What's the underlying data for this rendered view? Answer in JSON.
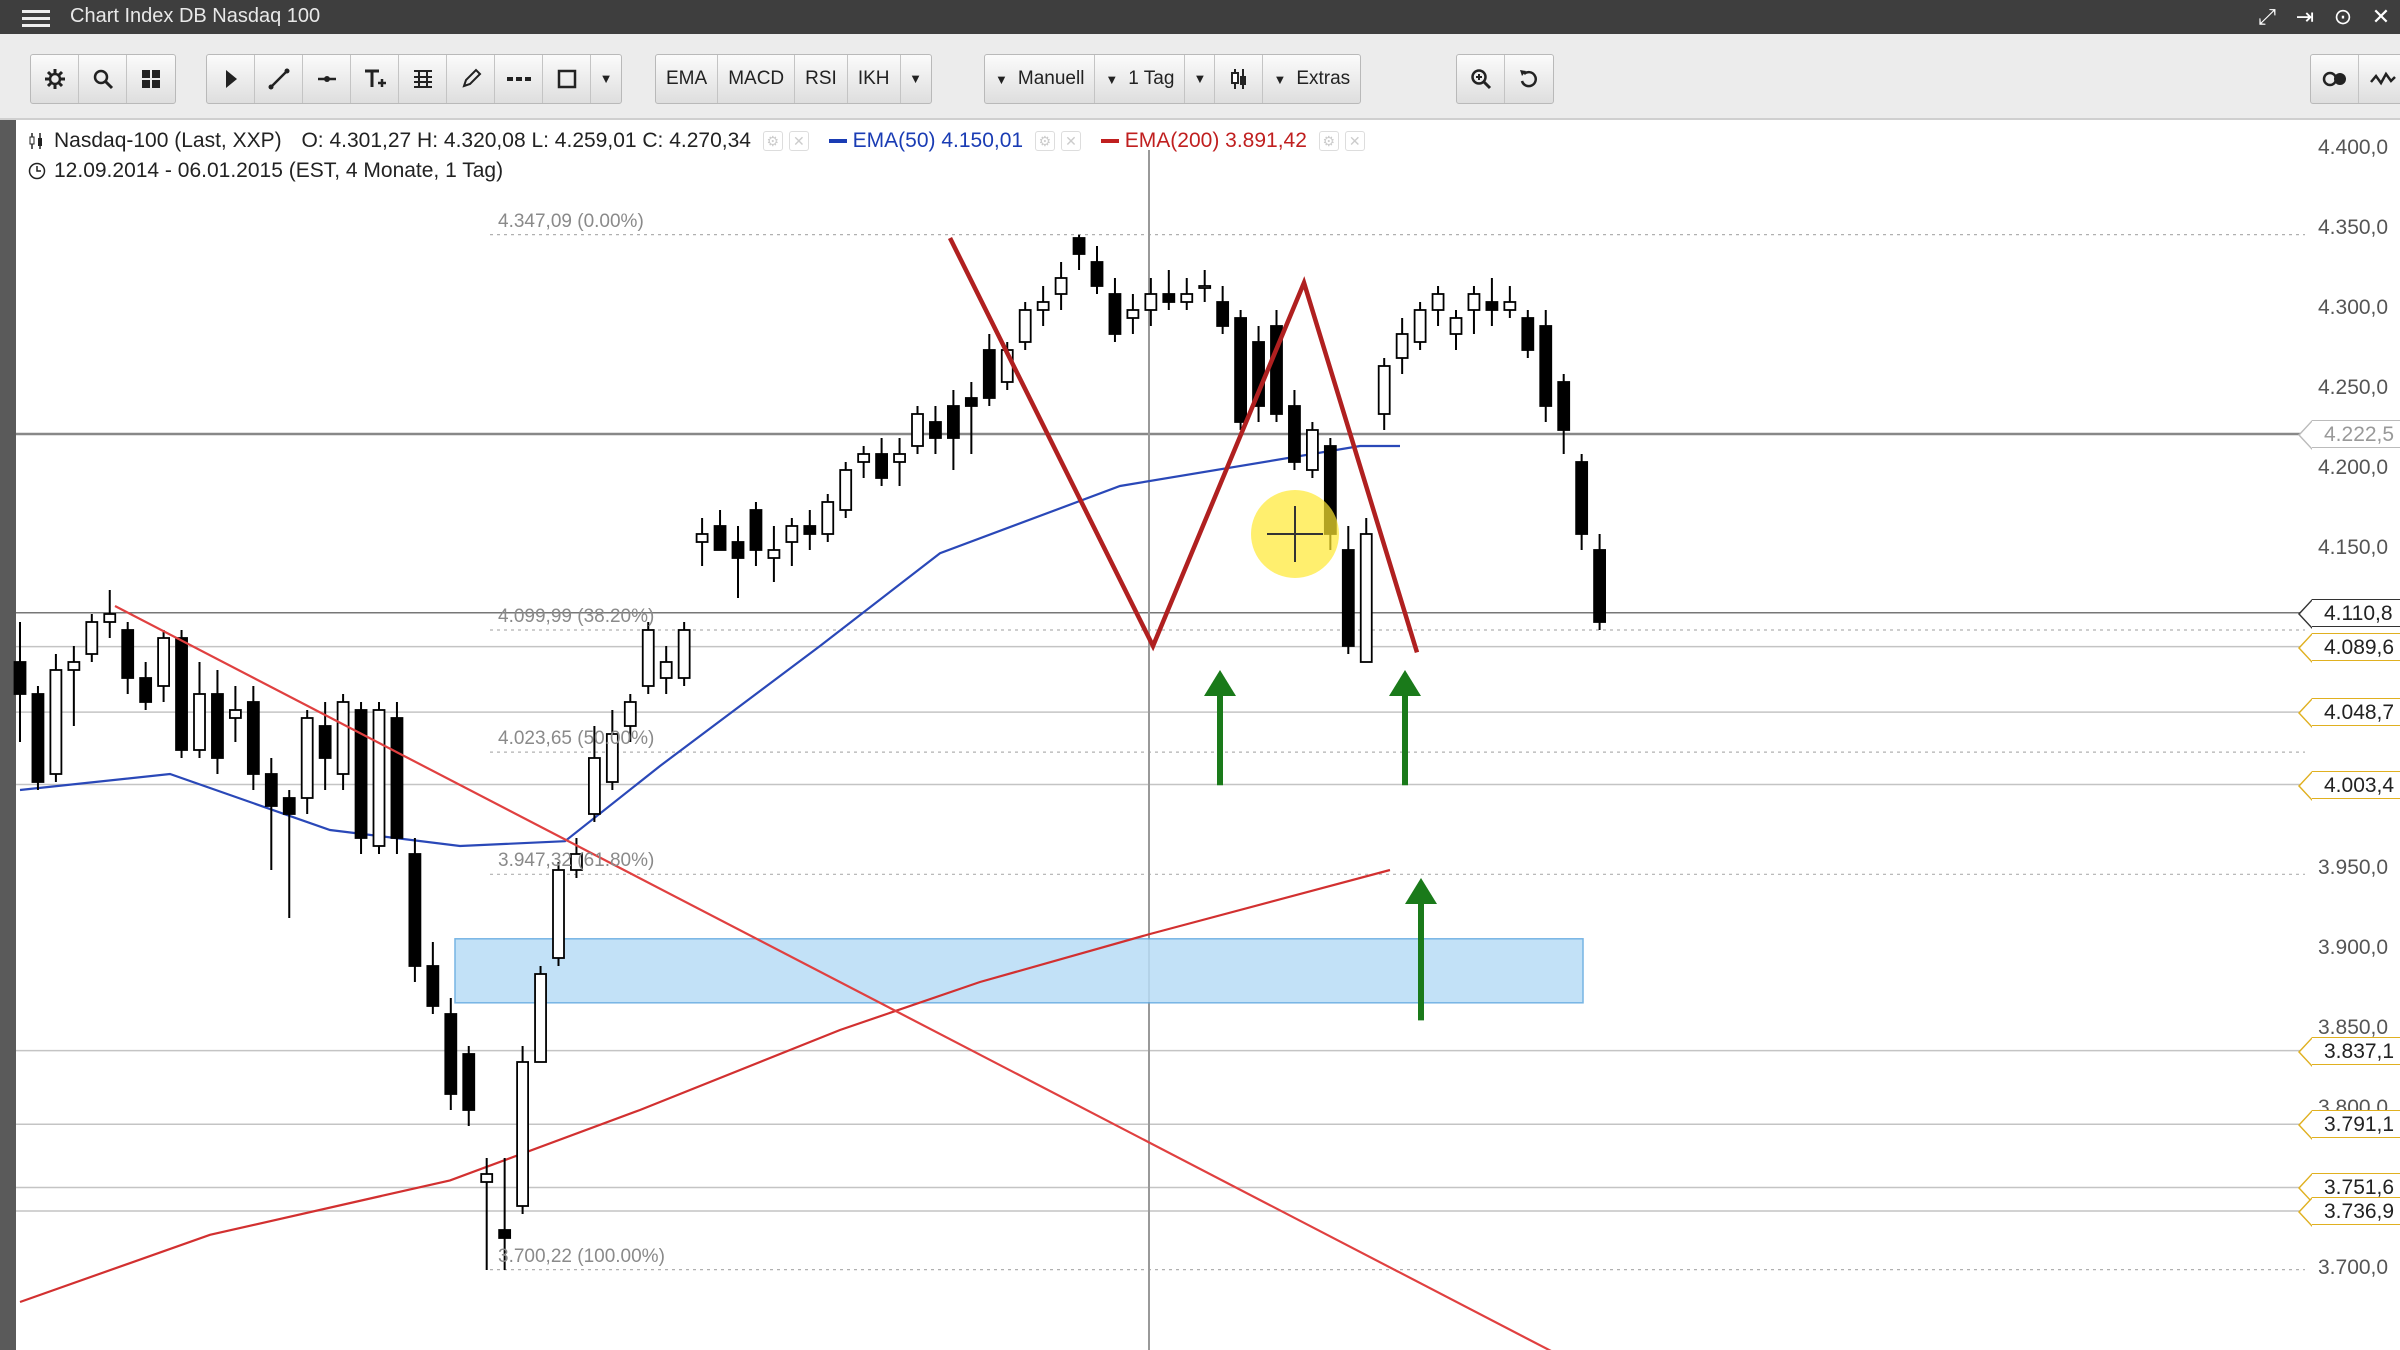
{
  "window": {
    "title": "Chart Index DB Nasdaq 100",
    "buttons": [
      "⤢",
      "⇥",
      "⊙",
      "✕"
    ]
  },
  "toolbar": {
    "ema_label": "EMA",
    "macd_label": "MACD",
    "rsi_label": "RSI",
    "ikh_label": "IKH",
    "manual_label": "Manuell",
    "period_label": "1 Tag",
    "extras_label": "Extras"
  },
  "chart_info": {
    "instrument": "Nasdaq-100 (Last, XXP)",
    "ohlc": "O: 4.301,27   H: 4.320,08   L: 4.259,01   C: 4.270,34",
    "ema50": "EMA(50)  4.150,01",
    "ema200": "EMA(200)  3.891,42",
    "range": "12.09.2014 - 06.01.2015 (EST, 4 Monate, 1 Tag)",
    "ema50_color": "#1a3cb4",
    "ema200_color": "#c01f1f"
  },
  "fib_labels": [
    {
      "text": "4.347,09 (0.00%)",
      "price": 4347.09
    },
    {
      "text": "4.099,99 (38.20%)",
      "price": 4099.99
    },
    {
      "text": "4.023,65 (50.00%)",
      "price": 4023.65
    },
    {
      "text": "3.947,32 (61.80%)",
      "price": 3947.32
    },
    {
      "text": "3.700,22 (100.00%)",
      "price": 3700.22
    }
  ],
  "y_axis": {
    "labels": [
      {
        "text": "4.400,0",
        "price": 4400
      },
      {
        "text": "4.350,0",
        "price": 4350
      },
      {
        "text": "4.300,0",
        "price": 4300
      },
      {
        "text": "4.250,0",
        "price": 4250
      },
      {
        "text": "4.200,0",
        "price": 4200
      },
      {
        "text": "4.150,0",
        "price": 4150
      },
      {
        "text": "3.950,0",
        "price": 3950
      },
      {
        "text": "3.900,0",
        "price": 3900
      },
      {
        "text": "3.850,0",
        "price": 3850
      },
      {
        "text": "3.800,0",
        "price": 3800
      },
      {
        "text": "3.700,0",
        "price": 3700
      }
    ],
    "tags": [
      {
        "text": "4.222,5",
        "price": 4222.5,
        "style": "gray"
      },
      {
        "text": "4.110,8",
        "price": 4110.8,
        "style": "dark"
      },
      {
        "text": "4.089,6",
        "price": 4089.6,
        "style": "gold"
      },
      {
        "text": "4.048,7",
        "price": 4048.7,
        "style": "gold"
      },
      {
        "text": "4.003,4",
        "price": 4003.4,
        "style": "gold"
      },
      {
        "text": "3.837,1",
        "price": 3837.1,
        "style": "gold"
      },
      {
        "text": "3.791,1",
        "price": 3791.1,
        "style": "gold"
      },
      {
        "text": "3.751,6",
        "price": 3751.6,
        "style": "gold"
      },
      {
        "text": "3.736,9",
        "price": 3736.9,
        "style": "gold"
      }
    ]
  },
  "colors": {
    "up": "#ffffff",
    "down": "#000000",
    "trend": "#e04040",
    "pattern": "#b02020",
    "arrow": "#1a7a1a",
    "zone": "#b8dcf6",
    "zone_border": "#5fa8e0"
  },
  "chart_data": {
    "type": "candlestick",
    "title": "Nasdaq-100 (Last, XXP)",
    "x": "12.09.2014 - 06.01.2015",
    "ylim": [
      3670,
      4420
    ],
    "candles": [
      [
        4080,
        4105,
        4030,
        4060
      ],
      [
        4060,
        4065,
        4000,
        4005
      ],
      [
        4010,
        4085,
        4005,
        4075
      ],
      [
        4075,
        4090,
        4040,
        4080
      ],
      [
        4085,
        4110,
        4080,
        4105
      ],
      [
        4105,
        4125,
        4095,
        4110
      ],
      [
        4100,
        4105,
        4060,
        4070
      ],
      [
        4070,
        4080,
        4050,
        4055
      ],
      [
        4065,
        4100,
        4055,
        4095
      ],
      [
        4095,
        4100,
        4020,
        4025
      ],
      [
        4025,
        4080,
        4020,
        4060
      ],
      [
        4060,
        4075,
        4010,
        4020
      ],
      [
        4045,
        4065,
        4030,
        4050
      ],
      [
        4055,
        4065,
        4000,
        4010
      ],
      [
        4010,
        4020,
        3950,
        3990
      ],
      [
        3995,
        4000,
        3920,
        3985
      ],
      [
        3995,
        4050,
        3985,
        4045
      ],
      [
        4040,
        4055,
        4000,
        4020
      ],
      [
        4010,
        4060,
        4000,
        4055
      ],
      [
        4050,
        4055,
        3960,
        3970
      ],
      [
        3965,
        4055,
        3960,
        4050
      ],
      [
        4045,
        4055,
        3960,
        3970
      ],
      [
        3960,
        3970,
        3880,
        3890
      ],
      [
        3890,
        3905,
        3860,
        3865
      ],
      [
        3860,
        3870,
        3800,
        3810
      ],
      [
        3835,
        3840,
        3790,
        3800
      ],
      [
        3755,
        3770,
        3700,
        3760
      ],
      [
        3725,
        3770,
        3700,
        3720
      ],
      [
        3740,
        3840,
        3735,
        3830
      ],
      [
        3830,
        3890,
        3830,
        3885
      ],
      [
        3895,
        3955,
        3890,
        3950
      ],
      [
        3950,
        3970,
        3945,
        3960
      ],
      [
        3985,
        4040,
        3980,
        4020
      ],
      [
        4005,
        4050,
        4000,
        4035
      ],
      [
        4040,
        4060,
        4030,
        4055
      ],
      [
        4065,
        4105,
        4060,
        4100
      ],
      [
        4070,
        4090,
        4060,
        4080
      ],
      [
        4070,
        4105,
        4065,
        4100
      ],
      [
        4155,
        4170,
        4140,
        4160
      ],
      [
        4165,
        4175,
        4150,
        4150
      ],
      [
        4155,
        4165,
        4120,
        4145
      ],
      [
        4175,
        4180,
        4140,
        4150
      ],
      [
        4145,
        4165,
        4130,
        4150
      ],
      [
        4155,
        4170,
        4140,
        4165
      ],
      [
        4165,
        4175,
        4150,
        4160
      ],
      [
        4160,
        4185,
        4155,
        4180
      ],
      [
        4175,
        4205,
        4170,
        4200
      ],
      [
        4205,
        4215,
        4195,
        4210
      ],
      [
        4210,
        4220,
        4190,
        4195
      ],
      [
        4205,
        4220,
        4190,
        4210
      ],
      [
        4215,
        4240,
        4210,
        4235
      ],
      [
        4230,
        4240,
        4210,
        4220
      ],
      [
        4240,
        4250,
        4200,
        4220
      ],
      [
        4245,
        4255,
        4210,
        4240
      ],
      [
        4275,
        4285,
        4240,
        4245
      ],
      [
        4255,
        4280,
        4250,
        4275
      ],
      [
        4280,
        4305,
        4275,
        4300
      ],
      [
        4300,
        4315,
        4290,
        4305
      ],
      [
        4310,
        4330,
        4300,
        4320
      ],
      [
        4345,
        4347,
        4325,
        4335
      ],
      [
        4330,
        4340,
        4310,
        4315
      ],
      [
        4310,
        4320,
        4280,
        4285
      ],
      [
        4295,
        4310,
        4285,
        4300
      ],
      [
        4300,
        4320,
        4290,
        4310
      ],
      [
        4310,
        4325,
        4300,
        4305
      ],
      [
        4305,
        4320,
        4300,
        4310
      ],
      [
        4315,
        4325,
        4305,
        4315
      ],
      [
        4305,
        4315,
        4285,
        4290
      ],
      [
        4295,
        4300,
        4225,
        4230
      ],
      [
        4280,
        4290,
        4230,
        4240
      ],
      [
        4290,
        4300,
        4230,
        4235
      ],
      [
        4240,
        4250,
        4200,
        4205
      ],
      [
        4200,
        4230,
        4195,
        4225
      ],
      [
        4215,
        4220,
        4150,
        4160
      ],
      [
        4150,
        4165,
        4085,
        4090
      ],
      [
        4080,
        4170,
        4080,
        4160
      ],
      [
        4235,
        4270,
        4225,
        4265
      ],
      [
        4270,
        4295,
        4260,
        4285
      ],
      [
        4280,
        4305,
        4275,
        4300
      ],
      [
        4300,
        4315,
        4290,
        4310
      ],
      [
        4285,
        4300,
        4275,
        4295
      ],
      [
        4300,
        4315,
        4285,
        4310
      ],
      [
        4305,
        4320,
        4290,
        4300
      ],
      [
        4300,
        4315,
        4295,
        4305
      ],
      [
        4295,
        4300,
        4270,
        4275
      ],
      [
        4290,
        4300,
        4230,
        4240
      ],
      [
        4255,
        4260,
        4210,
        4225
      ],
      [
        4205,
        4210,
        4150,
        4160
      ],
      [
        4150,
        4160,
        4100,
        4105
      ]
    ],
    "ema50": [
      [
        0,
        4000
      ],
      [
        150,
        4010
      ],
      [
        310,
        3975
      ],
      [
        440,
        3965
      ],
      [
        545,
        3968
      ],
      [
        640,
        4015
      ],
      [
        800,
        4090
      ],
      [
        920,
        4148
      ],
      [
        1100,
        4190
      ],
      [
        1340,
        4215
      ],
      [
        1380,
        4215
      ]
    ],
    "ema200": [
      [
        0,
        3680
      ],
      [
        190,
        3722
      ],
      [
        430,
        3756
      ],
      [
        620,
        3800
      ],
      [
        820,
        3850
      ],
      [
        960,
        3880
      ],
      [
        1130,
        3910
      ],
      [
        1370,
        3950
      ]
    ],
    "trendline": [
      [
        95,
        4115
      ],
      [
        1560,
        3640
      ]
    ],
    "pattern_w": [
      [
        930,
        4345
      ],
      [
        1133,
        4090
      ],
      [
        1284,
        4317
      ],
      [
        1397,
        4086
      ]
    ],
    "zone": {
      "x0": 455,
      "x1": 1583,
      "top": 3907,
      "bottom": 3867
    },
    "arrows": [
      {
        "x": 1200,
        "from": 4003,
        "to": 4075
      },
      {
        "x": 1385,
        "from": 4003,
        "to": 4075
      },
      {
        "x": 1401,
        "from": 3856,
        "to": 3945
      }
    ],
    "crosshair": {
      "x": 1149,
      "price": 4160
    }
  }
}
